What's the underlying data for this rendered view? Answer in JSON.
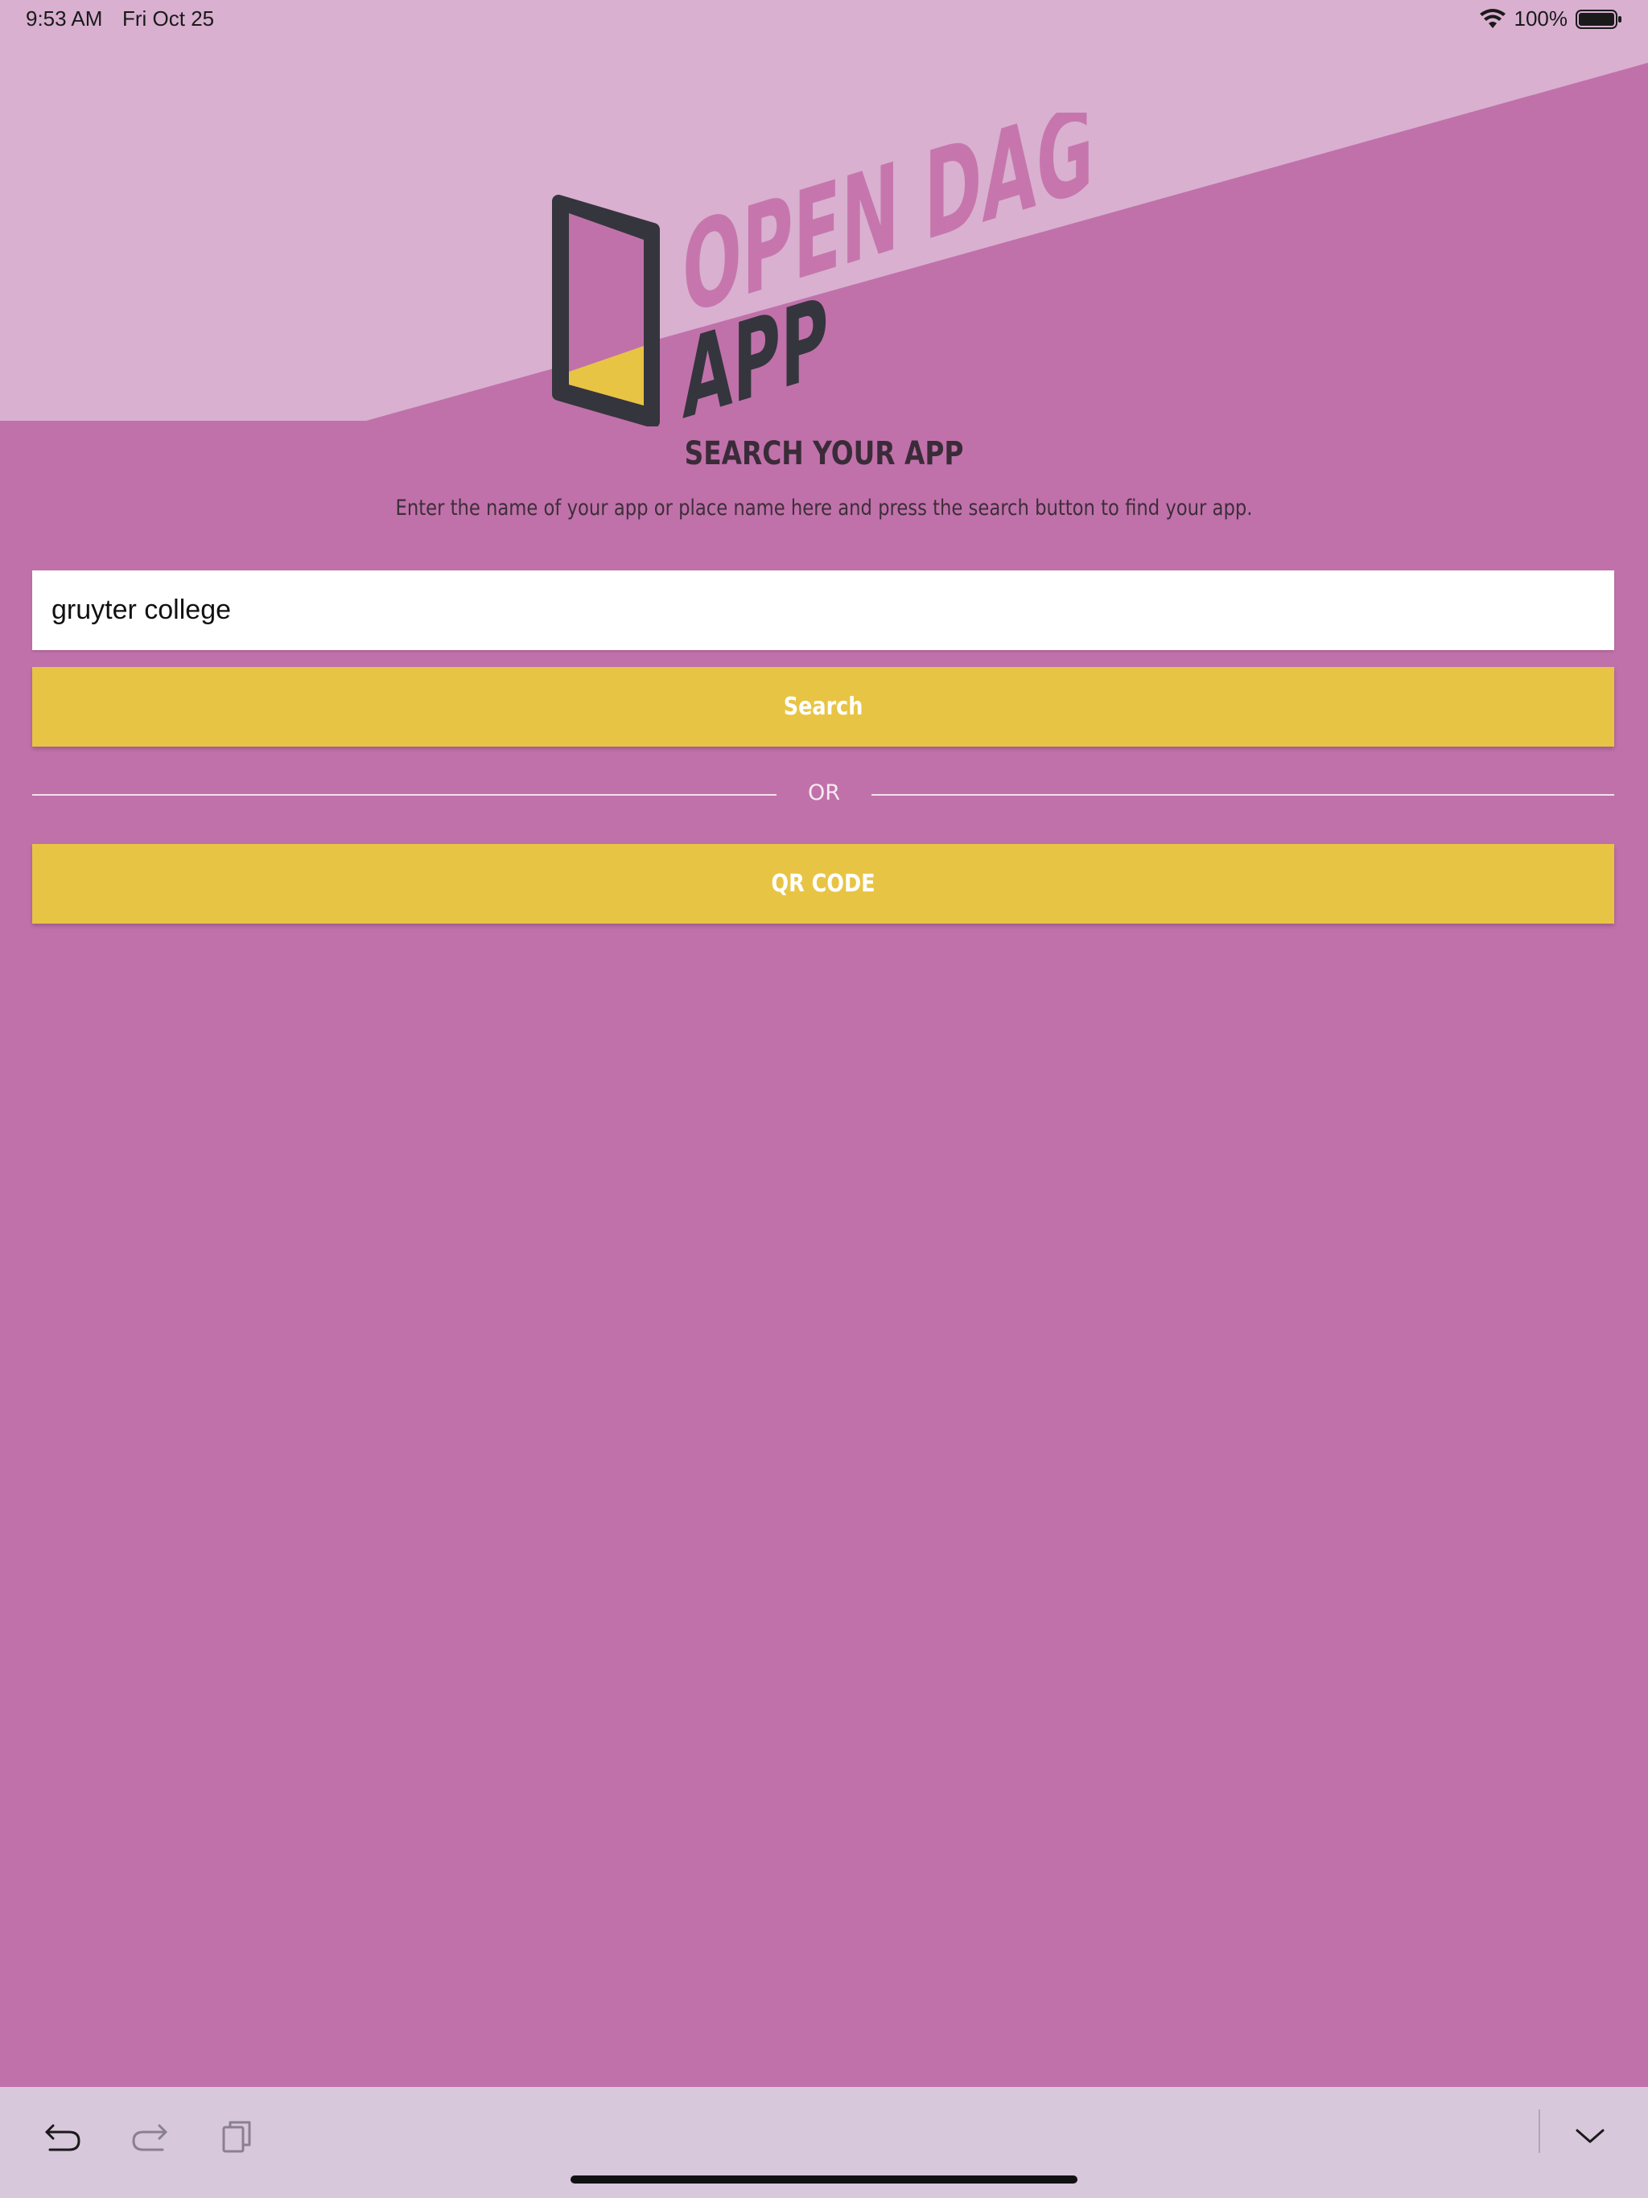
{
  "status_bar": {
    "time": "9:53 AM",
    "date": "Fri Oct 25",
    "battery": "100%",
    "wifi_icon": "wifi-icon",
    "battery_icon": "battery-icon"
  },
  "logo": {
    "line1": "OPEN DAG",
    "line2": "APP",
    "icon": "phone-icon"
  },
  "header": {
    "title": "SEARCH YOUR APP",
    "description": "Enter the name of your app or place name here and press the search button to find your app."
  },
  "search": {
    "value": "gruyter college",
    "button_label": "Search"
  },
  "divider": {
    "label": "OR"
  },
  "qr": {
    "button_label": "QR CODE"
  },
  "toolbar": {
    "icons": [
      "undo-icon",
      "redo-icon",
      "paste-icon",
      "chevron-down-icon"
    ]
  },
  "colors": {
    "background": "#c071aa",
    "top_band": "#d9b0d0",
    "logo_text": "#c676ad",
    "logo_dark": "#35353d",
    "accent_yellow": "#e8c444",
    "toolbar": "#d8c8dc"
  }
}
